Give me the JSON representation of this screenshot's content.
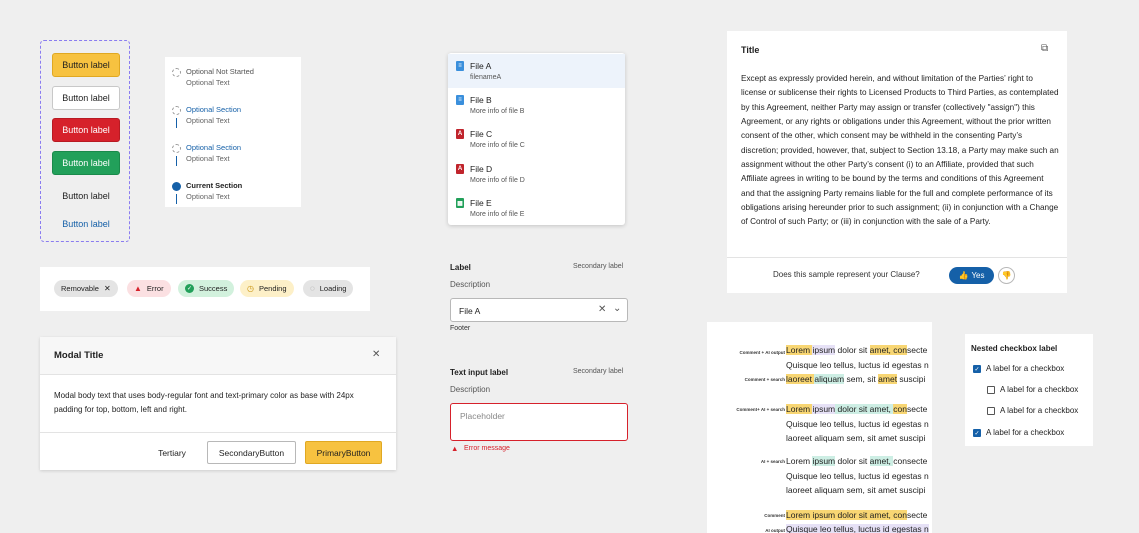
{
  "buttons": [
    "Button label",
    "Button label",
    "Button label",
    "Button label",
    "Button label",
    "Button label"
  ],
  "stepper": [
    {
      "title": "Optional Not Started",
      "sub": "Optional Text"
    },
    {
      "title": "Optional Section",
      "sub": "Optional Text"
    },
    {
      "title": "Optional Section",
      "sub": "Optional Text"
    },
    {
      "title": "Current Section",
      "sub": "Optional Text"
    }
  ],
  "tags": [
    "Removable",
    "Error",
    "Success",
    "Pending",
    "Loading"
  ],
  "modal": {
    "title": "Modal Title",
    "body": "Modal body text that uses body-regular font and text-primary color as base with 24px padding for top, bottom, left and right.",
    "tertiary": "Tertiary",
    "secondary": "SecondaryButton",
    "primary": "PrimaryButton"
  },
  "files": [
    {
      "name": "File A",
      "info": "filenameA",
      "type": "doc"
    },
    {
      "name": "File B",
      "info": "More info of file B",
      "type": "doc"
    },
    {
      "name": "File C",
      "info": "More info of file C",
      "type": "pdf"
    },
    {
      "name": "File D",
      "info": "More info of file D",
      "type": "pdf"
    },
    {
      "name": "File E",
      "info": "More info of file E",
      "type": "sheet"
    }
  ],
  "dropdown": {
    "label": "Label",
    "secondary": "Secondary label",
    "description": "Description",
    "value": "File A",
    "footer": "Footer"
  },
  "textinput": {
    "label": "Text input label",
    "secondary": "Secondary label",
    "description": "Description",
    "placeholder": "Placeholder",
    "error": "Error message"
  },
  "clause": {
    "title": "Title",
    "body": "Except as expressly provided herein, and without limitation of the Parties’ right to license or sublicense their rights to Licensed Products to Third Parties, as contemplated by this Agreement, neither Party may assign or transfer (collectively \"assign\") this Agreement, or any rights or obligations under this Agreement, without the prior written consent of the other, which consent may be withheld in the consenting Party’s discretion; provided, however, that, subject to Section 13.18, a Party may make such an assignment without the other Party’s consent (i) to an Affiliate, provided that such Affiliate agrees in writing to be bound by the terms and conditions of this Agreement and that the assigning Party remains liable for the full and complete performance of its obligations arising hereunder prior to such assignment; (ii) in conjunction with a Change of Control of such Party; or (iii) in conjunction with the sale of a Party.",
    "question": "Does this sample represent your Clause?",
    "yes": "Yes"
  },
  "highlights": {
    "labels": [
      "Comment + AI output",
      "Comment + search",
      "Comment+ AI + search",
      "AI + search",
      "Comment",
      "AI output"
    ],
    "line1": [
      "Lorem ",
      "ipsum",
      " dolor sit ",
      "amet, ",
      "con",
      "secte"
    ],
    "line2": "Quisque leo tellus, luctus id egestas n",
    "line3": [
      "laoreet ",
      "aliquam",
      " sem, sit ",
      "amet",
      " suscipi"
    ],
    "line3plain": "laoreet aliquam sem, sit amet suscipi"
  },
  "checkboxes": {
    "title": "Nested checkbox label",
    "items": [
      "A label for a checkbox",
      "A label for a checkbox",
      "A label for a checkbox",
      "A label for a checkbox"
    ]
  },
  "colors": {
    "accent": "#1560a8",
    "primary": "#f7c240",
    "danger": "#d6212b",
    "success": "#22a05a"
  }
}
